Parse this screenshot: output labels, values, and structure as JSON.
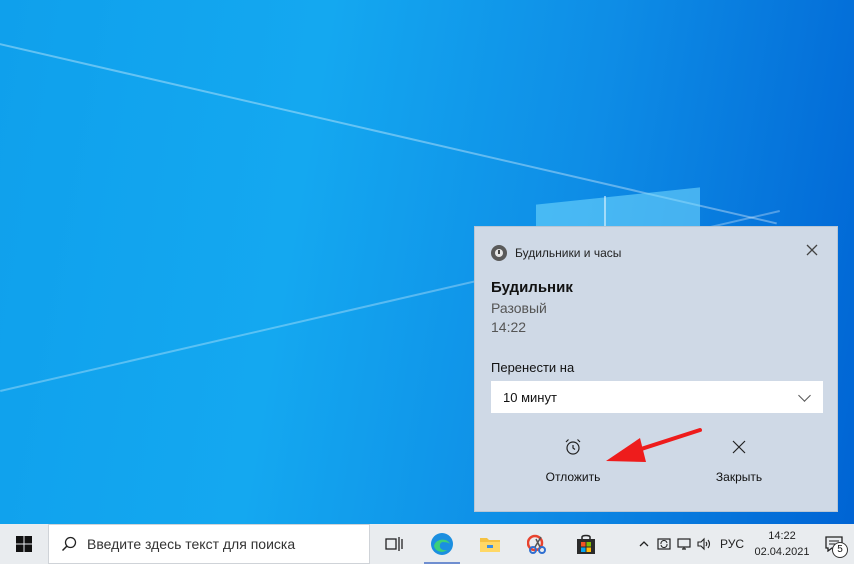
{
  "toast": {
    "app_name": "Будильники и часы",
    "title": "Будильник",
    "subtitle": "Разовый",
    "time": "14:22",
    "snooze_label": "Перенести на",
    "snooze_value": "10 минут",
    "action_snooze": "Отложить",
    "action_dismiss": "Закрыть"
  },
  "taskbar": {
    "search_placeholder": "Введите здесь текст для поиска",
    "language": "РУС",
    "time": "14:22",
    "date": "02.04.2021",
    "notification_count": "5",
    "icons": [
      "windows-start-icon",
      "search-icon",
      "task-view-icon",
      "edge-icon",
      "file-explorer-icon",
      "snipping-tool-icon",
      "store-icon"
    ]
  },
  "colors": {
    "annotation_arrow": "#ee1c1c",
    "toast_bg": "#cfd9e6",
    "taskbar_bg": "#e9ecef"
  }
}
